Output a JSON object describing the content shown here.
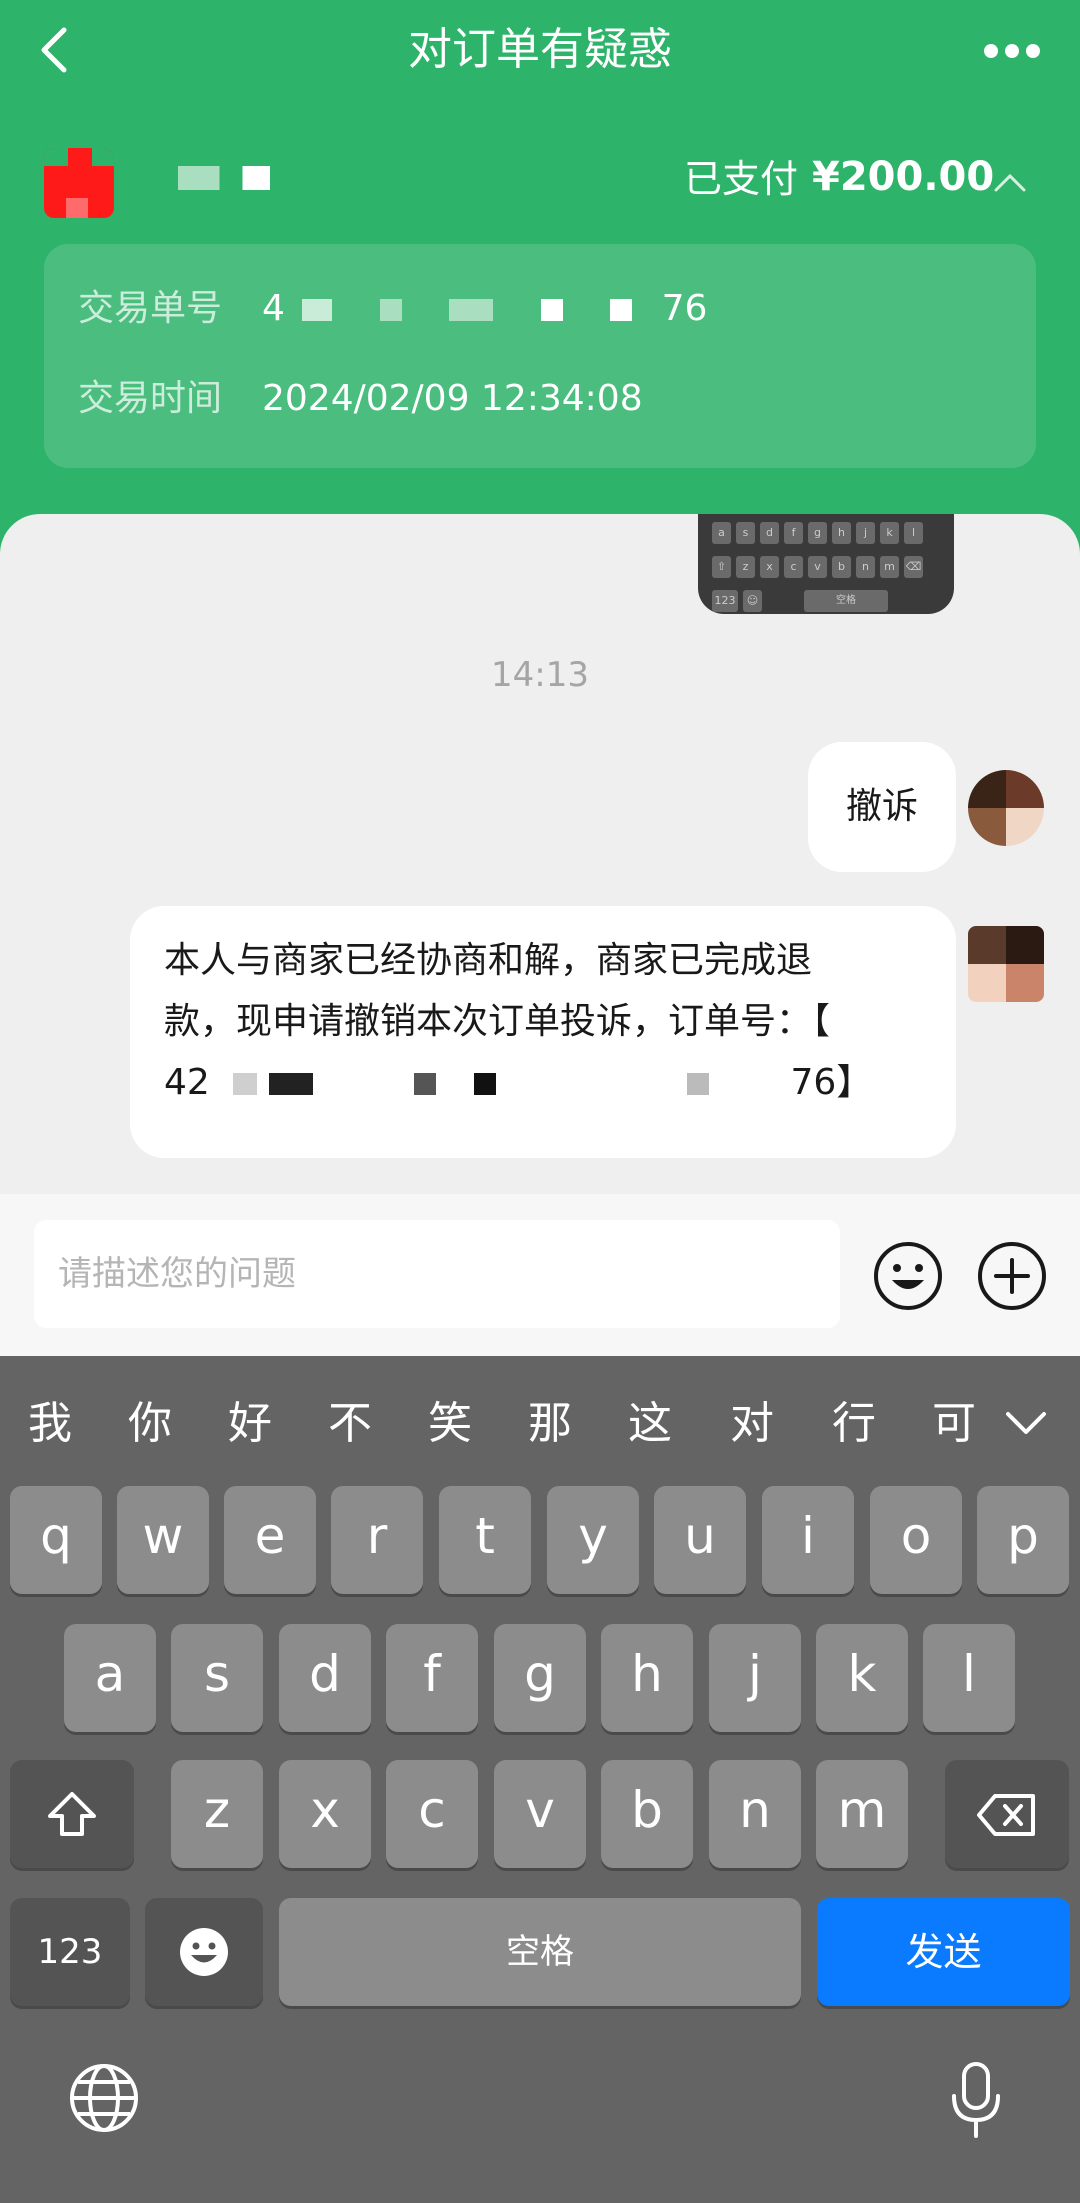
{
  "nav": {
    "title": "对订单有疑惑",
    "back_icon": "back-chevron-icon",
    "more_icon": "more-dots-icon"
  },
  "order": {
    "paid_label": "已支付",
    "paid_amount": "¥200.00",
    "transaction_no_label": "交易单号",
    "transaction_no_value_start": "4",
    "transaction_no_value_end": "76",
    "transaction_time_label": "交易时间",
    "transaction_time_value": "2024/02/09 12:34:08"
  },
  "chat": {
    "timestamp": "14:13",
    "messages": [
      {
        "text": "撤诉"
      },
      {
        "line1": "本人与商家已经协商和解，商家已完成退",
        "line2": "款，现申请撤销本次订单投诉，订单号：【",
        "line3_start": "42",
        "line3_end": "76】"
      }
    ]
  },
  "composer": {
    "placeholder": "请描述您的问题",
    "emoji_icon": "smiley-icon",
    "plus_icon": "plus-circle-icon"
  },
  "keyboard": {
    "candidates": [
      "我",
      "你",
      "好",
      "不",
      "笑",
      "那",
      "这",
      "对",
      "行",
      "可"
    ],
    "row1": [
      "q",
      "w",
      "e",
      "r",
      "t",
      "y",
      "u",
      "i",
      "o",
      "p"
    ],
    "row2": [
      "a",
      "s",
      "d",
      "f",
      "g",
      "h",
      "j",
      "k",
      "l"
    ],
    "row3": [
      "z",
      "x",
      "c",
      "v",
      "b",
      "n",
      "m"
    ],
    "num_key": "123",
    "space_key": "空格",
    "send_key": "发送",
    "colors": {
      "send": "#0a7aff",
      "header": "#2db36a"
    }
  }
}
